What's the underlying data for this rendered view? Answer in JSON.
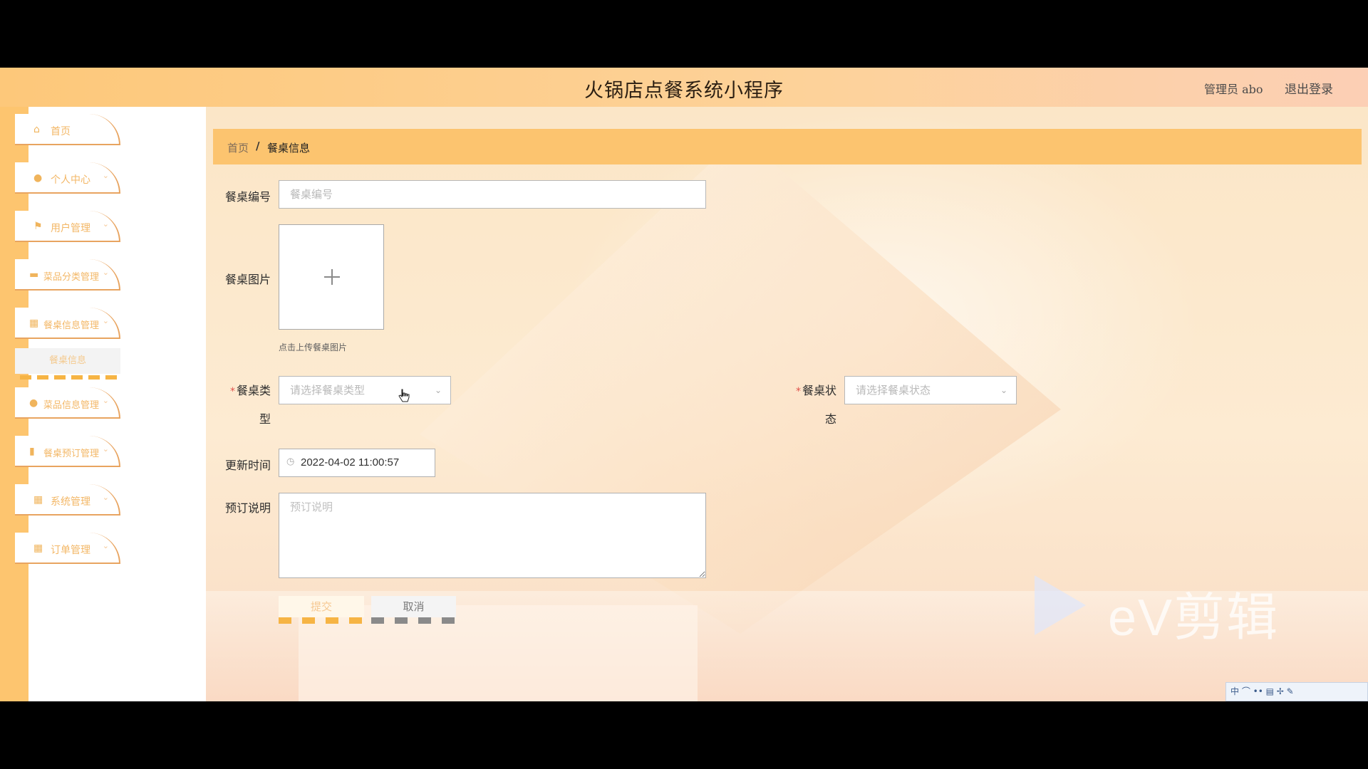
{
  "header": {
    "title": "火锅店点餐系统小程序",
    "user": "管理员 abo",
    "logout": "退出登录"
  },
  "sidebar": {
    "items": [
      {
        "label": "首页",
        "icon": "home-icon",
        "glyph": "⌂",
        "caret": ""
      },
      {
        "label": "个人中心",
        "icon": "user-icon",
        "glyph": "●",
        "caret": "⌄"
      },
      {
        "label": "用户管理",
        "icon": "flag-icon",
        "glyph": "⚑",
        "caret": "⌄"
      },
      {
        "label": "菜品分类管理",
        "icon": "chat-icon",
        "glyph": "▬",
        "caret": "⌄"
      },
      {
        "label": "餐桌信息管理",
        "icon": "grid-icon",
        "glyph": "▦",
        "caret": "⌄"
      },
      {
        "label": "菜品信息管理",
        "icon": "location-icon",
        "glyph": "●",
        "caret": "⌄"
      },
      {
        "label": "餐桌预订管理",
        "icon": "bar-chart-icon",
        "glyph": "▮",
        "caret": "⌄"
      },
      {
        "label": "系统管理",
        "icon": "apps-icon",
        "glyph": "▦",
        "caret": "⌄"
      },
      {
        "label": "订单管理",
        "icon": "apps-icon",
        "glyph": "▦",
        "caret": "⌄"
      }
    ],
    "sub_item": "餐桌信息"
  },
  "breadcrumb": {
    "home": "首页",
    "separator": "/",
    "current": "餐桌信息"
  },
  "form": {
    "table_no": {
      "label": "餐桌编号",
      "placeholder": "餐桌编号"
    },
    "table_image": {
      "label": "餐桌图片",
      "hint": "点击上传餐桌图片"
    },
    "table_type": {
      "required_mark": "*",
      "label_line1": "餐桌类",
      "label_line2": "型",
      "placeholder": "请选择餐桌类型"
    },
    "table_status": {
      "required_mark": "*",
      "label_line1": "餐桌状",
      "label_line2": "态",
      "placeholder": "请选择餐桌状态"
    },
    "update_time": {
      "label": "更新时间",
      "value": "2022-04-02 11:00:57"
    },
    "note": {
      "label": "预订说明",
      "placeholder": "预订说明"
    },
    "submit": "提交",
    "cancel": "取消"
  },
  "watermark": {
    "text": "eV剪辑"
  },
  "tray": {
    "text": "中 ⌒ •• ▤ ✢ ✎"
  },
  "colors": {
    "accent": "#fcc46f",
    "header_start": "#fdc87a",
    "sidebar_border": "#e8a460",
    "required": "#e0524c"
  }
}
